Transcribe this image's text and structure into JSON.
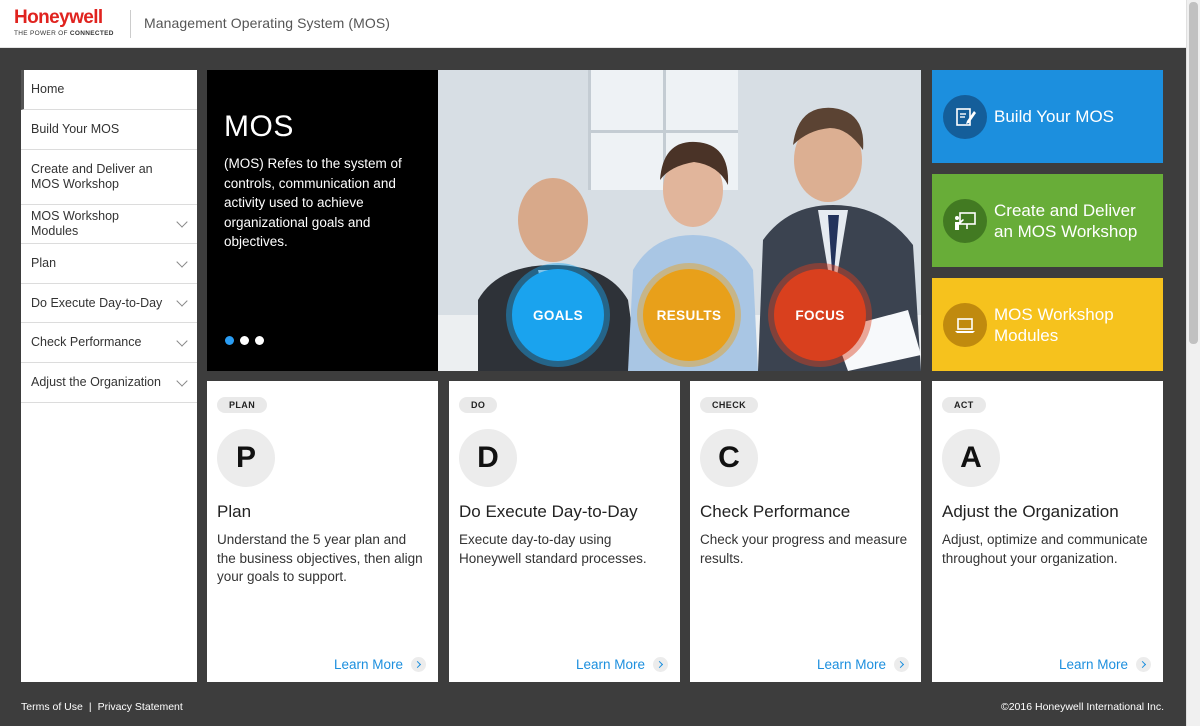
{
  "header": {
    "logo_word": "Honeywell",
    "logo_tag_prefix": "THE POWER OF",
    "logo_tag_bold": "CONNECTED",
    "app_title": "Management Operating System (MOS)"
  },
  "sidebar": {
    "items": [
      {
        "label": "Home",
        "expandable": false,
        "active": true
      },
      {
        "label": "Build Your MOS",
        "expandable": false
      },
      {
        "label": "Create and Deliver an MOS Workshop",
        "expandable": false
      },
      {
        "label": "MOS Workshop Modules",
        "expandable": true
      },
      {
        "label": "Plan",
        "expandable": true
      },
      {
        "label": "Do Execute Day-to-Day",
        "expandable": true
      },
      {
        "label": "Check Performance",
        "expandable": true
      },
      {
        "label": "Adjust the Organization",
        "expandable": true
      }
    ]
  },
  "hero": {
    "title": "MOS",
    "description": "(MOS) Refes to the system of controls, communication and activity used to achieve organizational goals and objectives.",
    "dots": 3,
    "active_dot": 0,
    "circles": [
      {
        "label": "GOALS",
        "color": "#1aa3ee"
      },
      {
        "label": "RESULTS",
        "color": "#e8a01a"
      },
      {
        "label": "FOCUS",
        "color": "#d9401e"
      }
    ]
  },
  "tiles": [
    {
      "label": "Build Your MOS",
      "icon": "edit-document-icon",
      "color": "#1c8fde"
    },
    {
      "label": "Create and Deliver an MOS Workshop",
      "icon": "presentation-board-icon",
      "color": "#68ad38"
    },
    {
      "label": "MOS Workshop Modules",
      "icon": "laptop-icon",
      "color": "#f6c21d"
    }
  ],
  "cards": [
    {
      "badge": "PLAN",
      "letter": "P",
      "heading": "Plan",
      "body": "Understand the 5 year plan and the business objectives, then align your goals to support.",
      "link": "Learn More"
    },
    {
      "badge": "DO",
      "letter": "D",
      "heading": "Do Execute Day-to-Day",
      "body": "Execute day-to-day using Honeywell standard processes.",
      "link": "Learn More"
    },
    {
      "badge": "CHECK",
      "letter": "C",
      "heading": "Check Performance",
      "body": "Check your progress and measure results.",
      "link": "Learn More"
    },
    {
      "badge": "ACT",
      "letter": "A",
      "heading": "Adjust the Organization",
      "body": "Adjust, optimize and communicate throughout your organization.",
      "link": "Learn More"
    }
  ],
  "footer": {
    "terms": "Terms of Use",
    "separator": "|",
    "privacy": "Privacy Statement",
    "copyright": "©2016 Honeywell International Inc."
  },
  "colors": {
    "brand_red": "#e0231f",
    "accent_blue": "#1c8fde",
    "background": "#3d3d3d"
  }
}
